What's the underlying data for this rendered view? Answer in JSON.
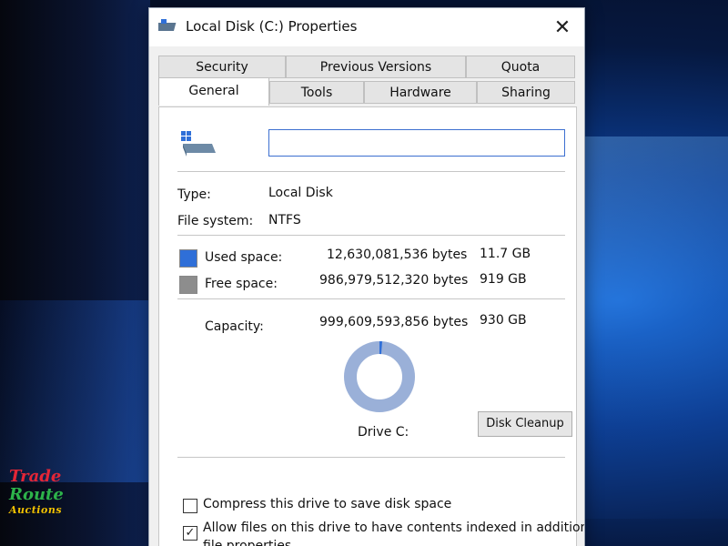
{
  "window": {
    "title": "Local Disk (C:) Properties",
    "close_glyph": "✕"
  },
  "tabs": {
    "row_back": [
      {
        "label": "Security"
      },
      {
        "label": "Previous Versions"
      },
      {
        "label": "Quota"
      }
    ],
    "row_front": [
      {
        "label": "General",
        "active": true
      },
      {
        "label": "Tools"
      },
      {
        "label": "Hardware"
      },
      {
        "label": "Sharing"
      }
    ]
  },
  "general": {
    "drive_name_value": "",
    "type_label": "Type:",
    "type_value": "Local Disk",
    "fs_label": "File system:",
    "fs_value": "NTFS",
    "used": {
      "label": "Used space:",
      "bytes": "12,630,081,536 bytes",
      "size": "11.7 GB",
      "color": "#2f6fd8"
    },
    "free": {
      "label": "Free space:",
      "bytes": "986,979,512,320 bytes",
      "size": "919 GB",
      "color": "#8d8d8d"
    },
    "capacity": {
      "label": "Capacity:",
      "bytes": "999,609,593,856 bytes",
      "size": "930 GB"
    },
    "used_fraction": 0.0126,
    "drive_label": "Drive C:",
    "cleanup_button": "Disk Cleanup",
    "compress": {
      "label": "Compress this drive to save disk space",
      "checked": false
    },
    "index": {
      "label": "Allow files on this drive to have contents indexed in addition to",
      "label2": "file properties",
      "checked": true,
      "check_glyph": "✓"
    }
  },
  "icons": {
    "title": "drive-icon",
    "drive": "windows-drive-icon",
    "close": "close-icon"
  },
  "watermark": {
    "line1": "Trade",
    "line2": "Route",
    "line3": "Auctions"
  }
}
